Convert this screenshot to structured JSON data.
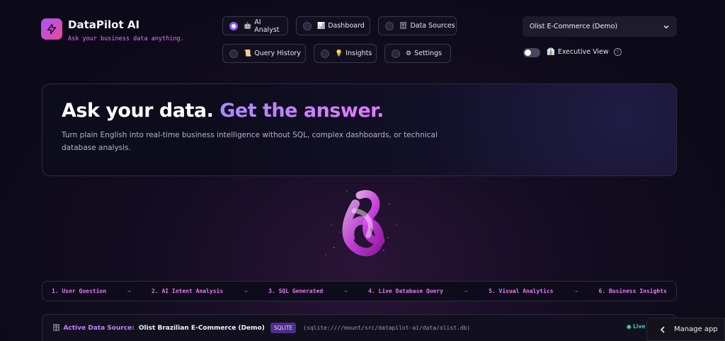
{
  "app": {
    "title": "DataPilot AI",
    "tagline": "Ask your business data anything."
  },
  "nav": {
    "items": [
      {
        "label": "AI Analyst",
        "icon": "🤖",
        "selected": true
      },
      {
        "label": "Dashboard",
        "icon": "📊",
        "selected": false
      },
      {
        "label": "Data Sources",
        "icon": "🗄",
        "selected": false
      },
      {
        "label": "Query History",
        "icon": "📜",
        "selected": false
      },
      {
        "label": "Insights",
        "icon": "💡",
        "selected": false
      },
      {
        "label": "Settings",
        "icon": "⚙",
        "selected": false
      }
    ]
  },
  "datasource_select": {
    "value": "Olist E-Commerce (Demo)"
  },
  "executive_view": {
    "label": "Executive View",
    "icon": "👔",
    "enabled": false
  },
  "hero": {
    "title_part1": "Ask your data.",
    "title_part2": "Get the answer.",
    "subtitle": "Turn plain English into real-time business intelligence without SQL, complex dashboards, or technical database analysis."
  },
  "pipeline": {
    "steps": [
      "1. User Question",
      "2. AI Intent Analysis",
      "3. SQL Generated",
      "4. Live Database Query",
      "5. Visual Analytics",
      "6. Business Insights"
    ],
    "arrow": "→"
  },
  "active_source": {
    "label": "Active Data Source:",
    "name": "Olist Brazilian E-Commerce (Demo)",
    "engine": "SQLITE",
    "path": "(sqlite:////mount/src/datapilot-ai/data/olist.db)",
    "status": "● Live"
  },
  "manage_app": {
    "label": "Manage app"
  },
  "colors": {
    "accent": "#8b5cf6",
    "pink": "#e879f9",
    "live": "#34d399"
  }
}
